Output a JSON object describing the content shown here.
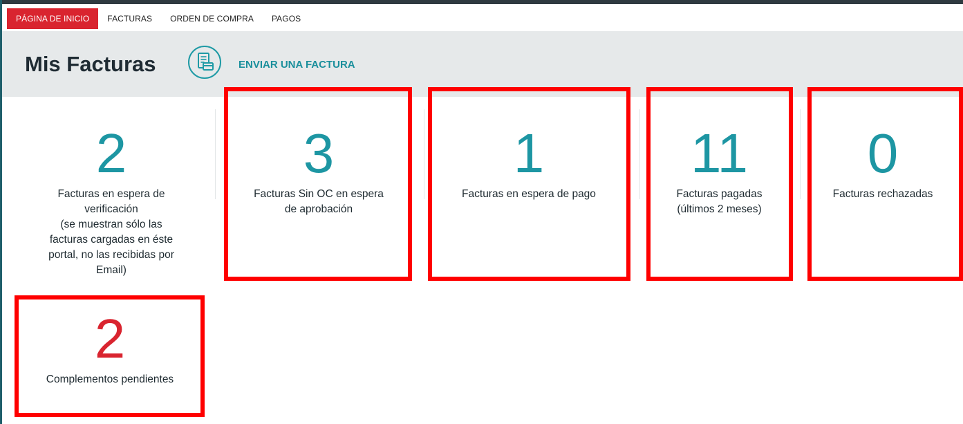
{
  "nav": {
    "items": [
      {
        "label": "PÁGINA DE INICIO",
        "active": true
      },
      {
        "label": "FACTURAS",
        "active": false
      },
      {
        "label": "ORDEN DE COMPRA",
        "active": false
      },
      {
        "label": "PAGOS",
        "active": false
      }
    ]
  },
  "header": {
    "title": "Mis Facturas",
    "send_icon": "invoice-card-icon",
    "send_label": "ENVIAR UNA FACTURA"
  },
  "stats": [
    {
      "count": "2",
      "label_lines": [
        "Facturas en espera de",
        "verificación",
        "(se muestran sólo las",
        "facturas cargadas en éste",
        "portal, no las recibidas por",
        "Email)"
      ]
    },
    {
      "count": "3",
      "label_lines": [
        "Facturas Sin OC en espera",
        "de aprobación"
      ]
    },
    {
      "count": "1",
      "label_lines": [
        "Facturas en espera de pago"
      ]
    },
    {
      "count": "11",
      "label_lines": [
        "Facturas pagadas",
        "(últimos 2 meses)"
      ]
    },
    {
      "count": "0",
      "label_lines": [
        "Facturas rechazadas"
      ]
    },
    {
      "count": "2",
      "label_lines": [
        "Complementos pendientes"
      ]
    }
  ],
  "colors": {
    "accent": "#1d96a3",
    "alert": "#d9242f",
    "highlight": "#ff0000",
    "header_bg": "#e6e9ea"
  }
}
